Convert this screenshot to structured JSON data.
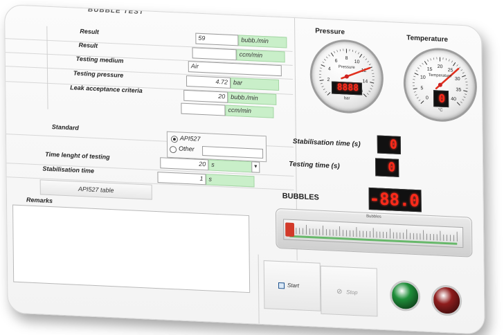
{
  "window": {
    "title": "BUBBLE TEST"
  },
  "form": {
    "result_label": "Result",
    "result_value": "59",
    "result_unit": "bubb./min",
    "result2_label": "Result",
    "result2_value": "",
    "result2_unit": "ccm/min",
    "medium_label": "Testing medium",
    "medium_value": "Air",
    "pressure_label": "Testing pressure",
    "pressure_value": "4.72",
    "pressure_unit": "bar",
    "leak_label": "Leak acceptance criteria",
    "leak_value": "20",
    "leak_unit": "bubb./min",
    "leak2_value": "",
    "leak2_unit": "ccm/min",
    "standard_label": "Standard",
    "standard_opt1": "API527",
    "standard_opt2": "Other",
    "standard_other_value": "",
    "time_label": "Time lenght of testing",
    "time_value": "20",
    "time_unit": "s",
    "stab_label": "Stabilisation time",
    "stab_value": "1",
    "stab_unit": "s",
    "table_button": "API527 table",
    "remarks_label": "Remarks",
    "remarks_value": ""
  },
  "gauges": {
    "pressure_title": "Pressure",
    "pressure_face_label": "Pressure",
    "pressure_unit": "bar",
    "pressure_ticks": [
      "0",
      "2",
      "4",
      "6",
      "8",
      "10",
      "12",
      "14",
      "16"
    ],
    "pressure_value": 12,
    "pressure_max": 16,
    "pressure_display": "8888",
    "temperature_title": "Temperature",
    "temperature_face_label": "Temperature",
    "temperature_unit": "°C",
    "temperature_ticks": [
      "0",
      "5",
      "10",
      "15",
      "20",
      "25",
      "30",
      "35",
      "40"
    ],
    "temperature_value": 27,
    "temperature_max": 40,
    "temperature_display": "0"
  },
  "timers": {
    "stabilisation_label": "Stabilisation time (s)",
    "stabilisation_display": "0",
    "testing_label": "Testing time (s)",
    "testing_display": "0",
    "bubbles_label": "BUBBLES",
    "bubbles_display": "-88.0"
  },
  "bar": {
    "title": "Bubbles",
    "level_fraction": 0.02
  },
  "controls": {
    "start_label": "Start",
    "stop_label": "Stop",
    "green_color": "#1f8f3a",
    "red_color": "#8f1d1d"
  }
}
